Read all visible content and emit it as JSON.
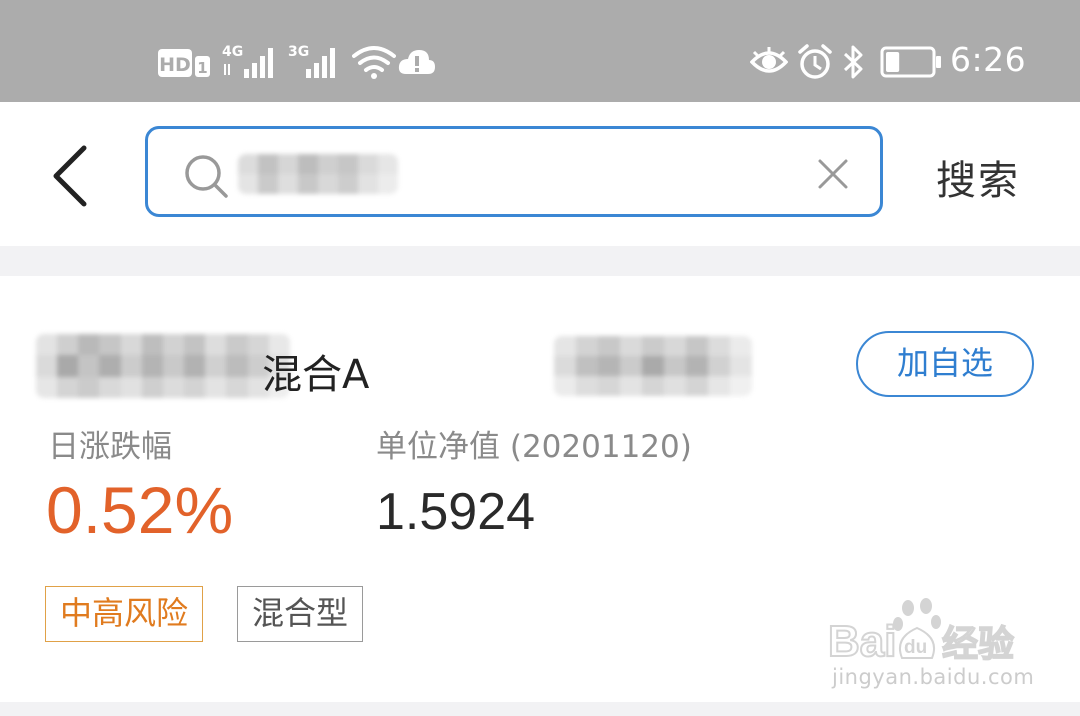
{
  "status_bar": {
    "time": "6:26",
    "indicators": {
      "hd": "HD",
      "sim": "1",
      "net1": "4G",
      "net2": "3G"
    },
    "icons": [
      "hd-icon",
      "signal-4g-icon",
      "signal-3g-icon",
      "wifi-icon",
      "cloud-alert-icon",
      "eye-icon",
      "alarm-icon",
      "bluetooth-icon",
      "battery-icon"
    ],
    "battery_level": 0.3
  },
  "header": {
    "search_placeholder": "",
    "search_button": "搜索"
  },
  "fund": {
    "name_visible": "混合A",
    "add_watchlist": "加自选",
    "daily_change_label": "日涨跌幅",
    "daily_change_value": "0.52%",
    "nav_label": "单位净值 (20201120)",
    "nav_value": "1.5924",
    "tags": [
      "中高风险",
      "混合型"
    ]
  },
  "watermark": {
    "brand": "Baidu经验",
    "url": "jingyan.baidu.com"
  },
  "colors": {
    "status_bar_bg": "#acacac",
    "accent_blue": "#3b87d4",
    "positive_change": "#e2622a",
    "risk_tag": "#e07b1f"
  }
}
